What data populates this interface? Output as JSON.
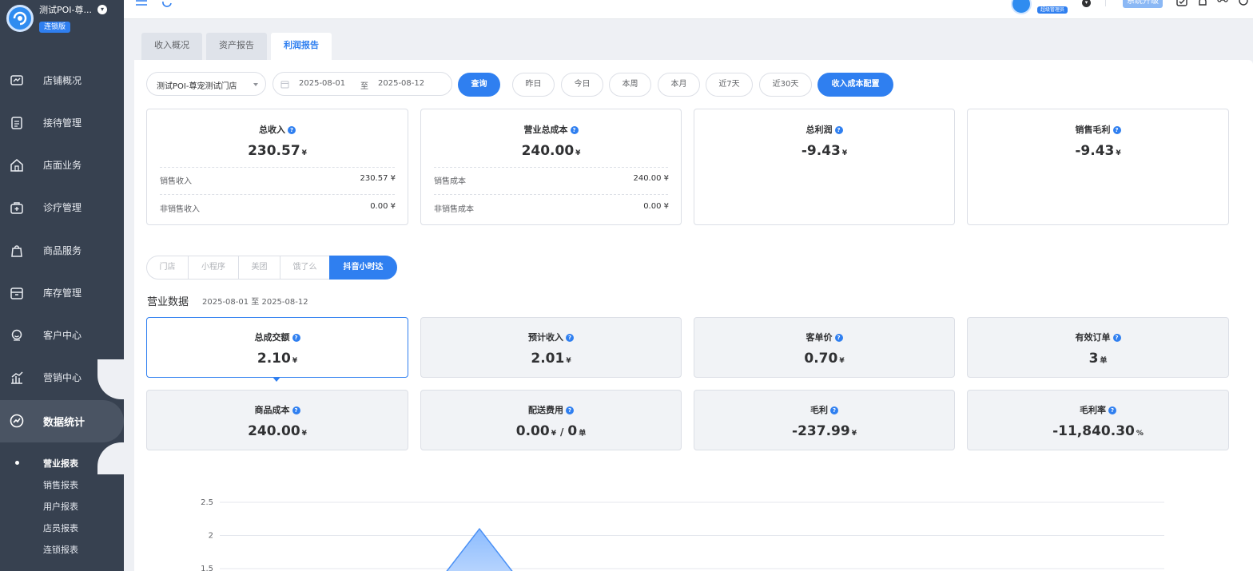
{
  "sidebar": {
    "store_name": "测试POI-尊...",
    "store_badge": "连锁版",
    "items": [
      {
        "label": "店铺概况",
        "icon": "dashboard-icon"
      },
      {
        "label": "接待管理",
        "icon": "reception-icon"
      },
      {
        "label": "店面业务",
        "icon": "store-icon"
      },
      {
        "label": "诊疗管理",
        "icon": "medical-kit-icon"
      },
      {
        "label": "商品服务",
        "icon": "bag-icon"
      },
      {
        "label": "库存管理",
        "icon": "inventory-icon"
      },
      {
        "label": "客户中心",
        "icon": "customer-icon"
      },
      {
        "label": "营销中心",
        "icon": "marketing-icon"
      },
      {
        "label": "数据统计",
        "icon": "chart-line-icon"
      }
    ],
    "sub_items": [
      "营业报表",
      "销售报表",
      "用户报表",
      "店员报表",
      "连锁报表"
    ]
  },
  "topbar": {
    "role_badge": "超级管理员",
    "upgrade_label": "系统升级"
  },
  "tabs": [
    "收入概况",
    "资产报告",
    "利润报告"
  ],
  "filters": {
    "store_select": "测试POI-尊宠测试门店",
    "date_start": "2025-08-01",
    "date_sep": "至",
    "date_end": "2025-08-12",
    "query_label": "查询",
    "quick_ranges": [
      "昨日",
      "今日",
      "本周",
      "本月",
      "近7天",
      "近30天"
    ],
    "config_label": "收入成本配置"
  },
  "summary": [
    {
      "title": "总收入",
      "value": "230.57",
      "unit": "¥",
      "rows": [
        {
          "label": "销售收入",
          "value": "230.57 ¥"
        },
        {
          "label": "非销售收入",
          "value": "0.00 ¥"
        }
      ]
    },
    {
      "title": "营业总成本",
      "value": "240.00",
      "unit": "¥",
      "rows": [
        {
          "label": "销售成本",
          "value": "240.00 ¥"
        },
        {
          "label": "非销售成本",
          "value": "0.00 ¥"
        }
      ]
    },
    {
      "title": "总利润",
      "value": "-9.43",
      "unit": "¥"
    },
    {
      "title": "销售毛利",
      "value": "-9.43",
      "unit": "¥"
    }
  ],
  "channels": [
    "门店",
    "小程序",
    "美团",
    "饿了么",
    "抖音小时达"
  ],
  "section": {
    "title": "营业数据",
    "range": "2025-08-01 至 2025-08-12"
  },
  "metrics": [
    {
      "title": "总成交额",
      "value": "2.10",
      "unit": "¥"
    },
    {
      "title": "预计收入",
      "value": "2.01",
      "unit": "¥"
    },
    {
      "title": "客单价",
      "value": "0.70",
      "unit": "¥"
    },
    {
      "title": "有效订单",
      "value": "3",
      "unit": "单"
    },
    {
      "title": "商品成本",
      "value": "240.00",
      "unit": "¥"
    },
    {
      "title": "配送费用",
      "value": "0.00",
      "unit": "¥",
      "slash": "/",
      "value2": "0",
      "unit2": "单"
    },
    {
      "title": "毛利",
      "value": "-237.99",
      "unit": "¥"
    },
    {
      "title": "毛利率",
      "value": "-11,840.30",
      "unit": "%"
    }
  ],
  "chart_data": {
    "type": "area",
    "y_ticks": [
      "2.5",
      "2",
      "1.5"
    ],
    "ylim": [
      1.5,
      2.5
    ],
    "peak_value": 2.1,
    "color": "#4a90f5"
  }
}
